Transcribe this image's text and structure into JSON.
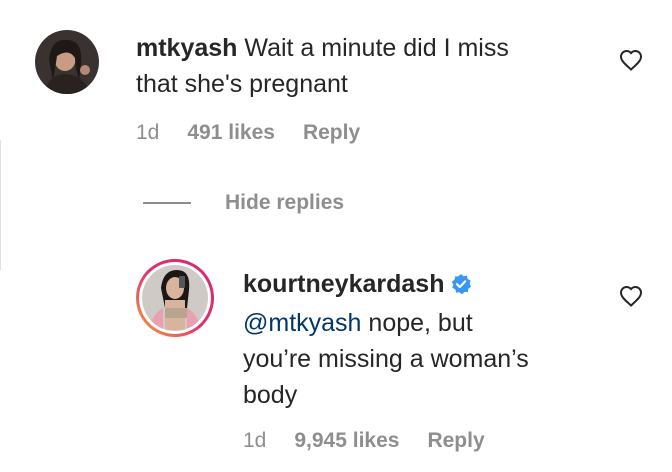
{
  "comment": {
    "username": "mtkyash",
    "text_line1": "Wait a minute did I miss",
    "text_line2": "that she's pregnant",
    "time": "1d",
    "likes": "491 likes",
    "reply": "Reply"
  },
  "thread": {
    "hide_replies": "Hide replies"
  },
  "reply_comment": {
    "username": "kourtneykardash",
    "mention": "@mtkyash",
    "text_line1_rest": " nope, but",
    "text_line2": "you’re missing a woman’s",
    "text_line3": "body",
    "time": "1d",
    "likes": "9,945 likes",
    "reply": "Reply"
  },
  "colors": {
    "text": "#262626",
    "secondary": "#8e8e8e",
    "mention": "#00376b",
    "verified": "#3897f0",
    "story_ring_start": "#f9a13a",
    "story_ring_end": "#d62976"
  }
}
